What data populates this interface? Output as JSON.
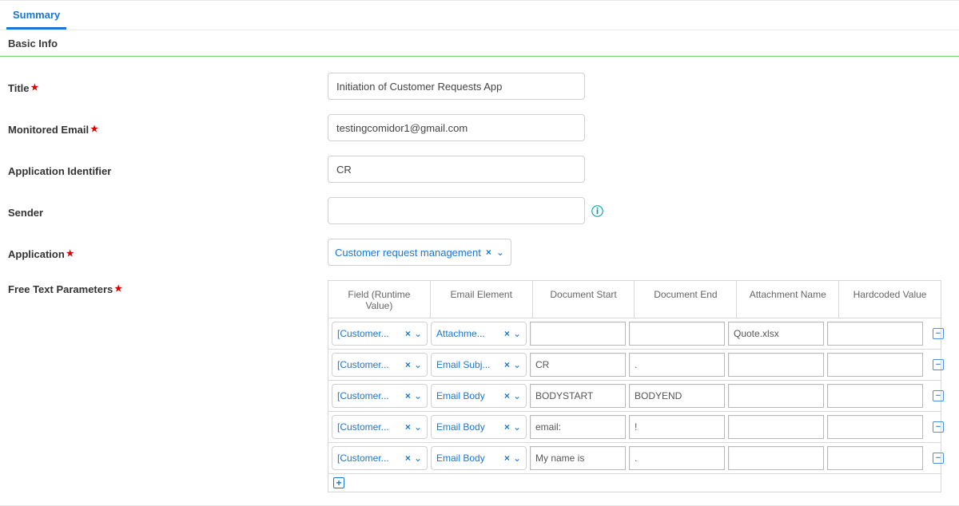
{
  "tabs": {
    "summary": "Summary"
  },
  "section": {
    "basic_info": "Basic Info"
  },
  "labels": {
    "title": "Title",
    "monitored_email": "Monitored Email",
    "application_identifier": "Application Identifier",
    "sender": "Sender",
    "application": "Application",
    "free_text_parameters": "Free Text Parameters"
  },
  "values": {
    "title": "Initiation of Customer Requests App",
    "monitored_email": "testingcomidor1@gmail.com",
    "application_identifier": "CR",
    "sender": "",
    "application": "Customer request management"
  },
  "columns": {
    "field": "Field (Runtime Value)",
    "email_element": "Email Element",
    "doc_start": "Document Start",
    "doc_end": "Document End",
    "attachment_name": "Attachment Name",
    "hardcoded": "Hardcoded Value"
  },
  "rows": [
    {
      "field": "[Customer...",
      "element": "Attachme...",
      "doc_start": "",
      "doc_end": "",
      "attachment": "Quote.xlsx",
      "hardcoded": ""
    },
    {
      "field": "[Customer...",
      "element": "Email Subj...",
      "doc_start": "CR",
      "doc_end": ".",
      "attachment": "",
      "hardcoded": ""
    },
    {
      "field": "[Customer...",
      "element": "Email Body",
      "doc_start": "BODYSTART",
      "doc_end": "BODYEND",
      "attachment": "",
      "hardcoded": ""
    },
    {
      "field": "[Customer...",
      "element": "Email Body",
      "doc_start": "email:",
      "doc_end": "!",
      "attachment": "",
      "hardcoded": ""
    },
    {
      "field": "[Customer...",
      "element": "Email Body",
      "doc_start": "My name is",
      "doc_end": ".",
      "attachment": "",
      "hardcoded": ""
    }
  ],
  "glyphs": {
    "x": "×",
    "chev": "⌄",
    "info": "ⓘ",
    "minus": "−",
    "plus": "+"
  }
}
